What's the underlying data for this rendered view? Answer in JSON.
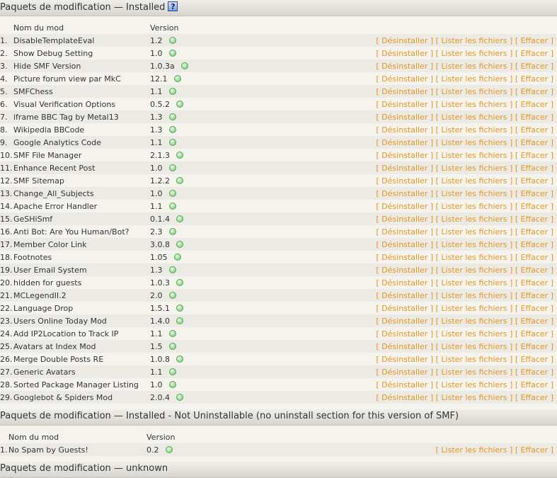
{
  "installed": {
    "title": "Paquets de modification — Installed",
    "help_icon": "help-icon",
    "headers": {
      "name": "Nom du mod",
      "version": "Version"
    },
    "actions": {
      "uninstall": "[ Désinstaller ]",
      "list": "[ Lister les fichiers ]",
      "delete": "[ Effacer ]"
    },
    "rows": [
      {
        "num": "1.",
        "name": "DisableTemplateEval",
        "version": "1.2"
      },
      {
        "num": "2.",
        "name": "Show Debug Setting",
        "version": "1.0"
      },
      {
        "num": "3.",
        "name": "Hide SMF Version",
        "version": "1.0.3a"
      },
      {
        "num": "4.",
        "name": "Picture forum view par MkC",
        "version": "12.1"
      },
      {
        "num": "5.",
        "name": "SMFChess",
        "version": "1.1"
      },
      {
        "num": "6.",
        "name": "Visual Verification Options",
        "version": "0.5.2"
      },
      {
        "num": "7.",
        "name": "iframe BBC Tag by Metal13",
        "version": "1.3"
      },
      {
        "num": "8.",
        "name": "Wikipedia BBCode",
        "version": "1.3"
      },
      {
        "num": "9.",
        "name": "Google Analytics Code",
        "version": "1.1"
      },
      {
        "num": "10.",
        "name": "SMF File Manager",
        "version": "2.1.3"
      },
      {
        "num": "11.",
        "name": "Enhance Recent Post",
        "version": "1.0"
      },
      {
        "num": "12.",
        "name": "SMF Sitemap",
        "version": "1.2.2"
      },
      {
        "num": "13.",
        "name": "Change_All_Subjects",
        "version": "1.0"
      },
      {
        "num": "14.",
        "name": "Apache Error Handler",
        "version": "1.1"
      },
      {
        "num": "15.",
        "name": "GeSHiSmf",
        "version": "0.1.4"
      },
      {
        "num": "16.",
        "name": "Anti Bot: Are You Human/Bot?",
        "version": "2.3"
      },
      {
        "num": "17.",
        "name": "Member Color Link",
        "version": "3.0.8"
      },
      {
        "num": "18.",
        "name": "Footnotes",
        "version": "1.05"
      },
      {
        "num": "19.",
        "name": "User Email System",
        "version": "1.3"
      },
      {
        "num": "20.",
        "name": "hidden for guests",
        "version": "1.0.3"
      },
      {
        "num": "21.",
        "name": "MCLegendII.2",
        "version": "2.0"
      },
      {
        "num": "22.",
        "name": "Language Drop",
        "version": "1.5.1"
      },
      {
        "num": "23.",
        "name": "Users Online Today Mod",
        "version": "1.4.0"
      },
      {
        "num": "24.",
        "name": "Add IP2Location to Track IP",
        "version": "1.1"
      },
      {
        "num": "25.",
        "name": "Avatars at Index Mod",
        "version": "1.5"
      },
      {
        "num": "26.",
        "name": "Merge Double Posts RE",
        "version": "1.0.8"
      },
      {
        "num": "27.",
        "name": "Generic Avatars",
        "version": "1.1"
      },
      {
        "num": "28.",
        "name": "Sorted Package Manager Listing",
        "version": "1.0"
      },
      {
        "num": "29.",
        "name": "Googlebot & Spiders Mod",
        "version": "2.0.4"
      }
    ]
  },
  "not_uninstallable": {
    "title": "Paquets de modification — Installed - Not Uninstallable (no uninstall section for this version of SMF)",
    "headers": {
      "name": "Nom du mod",
      "version": "Version"
    },
    "actions": {
      "list": "[ Lister les fichiers ]",
      "delete": "[ Effacer ]"
    },
    "rows": [
      {
        "num": "1.",
        "name": "No Spam by Guests!",
        "version": "0.2"
      }
    ]
  },
  "unknown": {
    "title": "Paquets de modification — unknown"
  },
  "colors": {
    "action_link": "#e6951e",
    "status_dot": "#8fd28a"
  }
}
